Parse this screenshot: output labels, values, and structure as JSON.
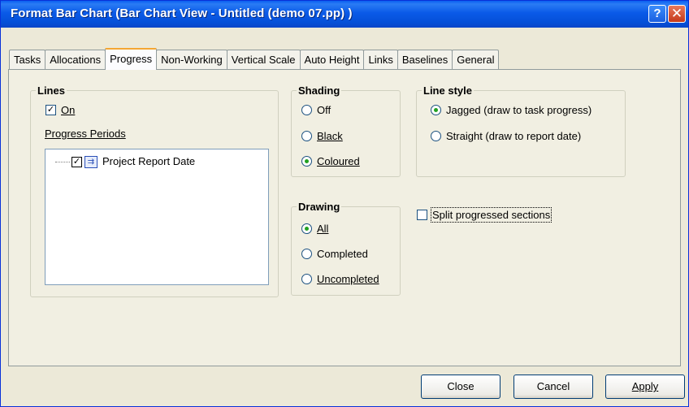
{
  "window": {
    "title": "Format Bar Chart (Bar Chart View - Untitled (demo 07.pp) )",
    "help_label": "?",
    "close_label": "✕"
  },
  "tabs": [
    "Tasks",
    "Allocations",
    "Progress",
    "Non-Working",
    "Vertical Scale",
    "Auto Height",
    "Links",
    "Baselines",
    "General"
  ],
  "active_tab": "Progress",
  "lines": {
    "legend": "Lines",
    "on_label": "On",
    "on_checked": true,
    "periods_label": "Progress Periods",
    "tree_items": [
      {
        "label": "Project Report Date",
        "checked": true
      }
    ]
  },
  "shading": {
    "legend": "Shading",
    "options": [
      "Off",
      "Black",
      "Coloured"
    ],
    "selected": "Coloured"
  },
  "line_style": {
    "legend": "Line style",
    "options": [
      "Jagged (draw to task progress)",
      "Straight (draw to report date)"
    ],
    "selected": "Jagged (draw to task progress)"
  },
  "drawing": {
    "legend": "Drawing",
    "options": [
      "All",
      "Completed",
      "Uncompleted"
    ],
    "selected": "All"
  },
  "split": {
    "label": "Split progressed sections",
    "checked": false
  },
  "buttons": {
    "close": "Close",
    "cancel": "Cancel",
    "apply": "Apply"
  }
}
